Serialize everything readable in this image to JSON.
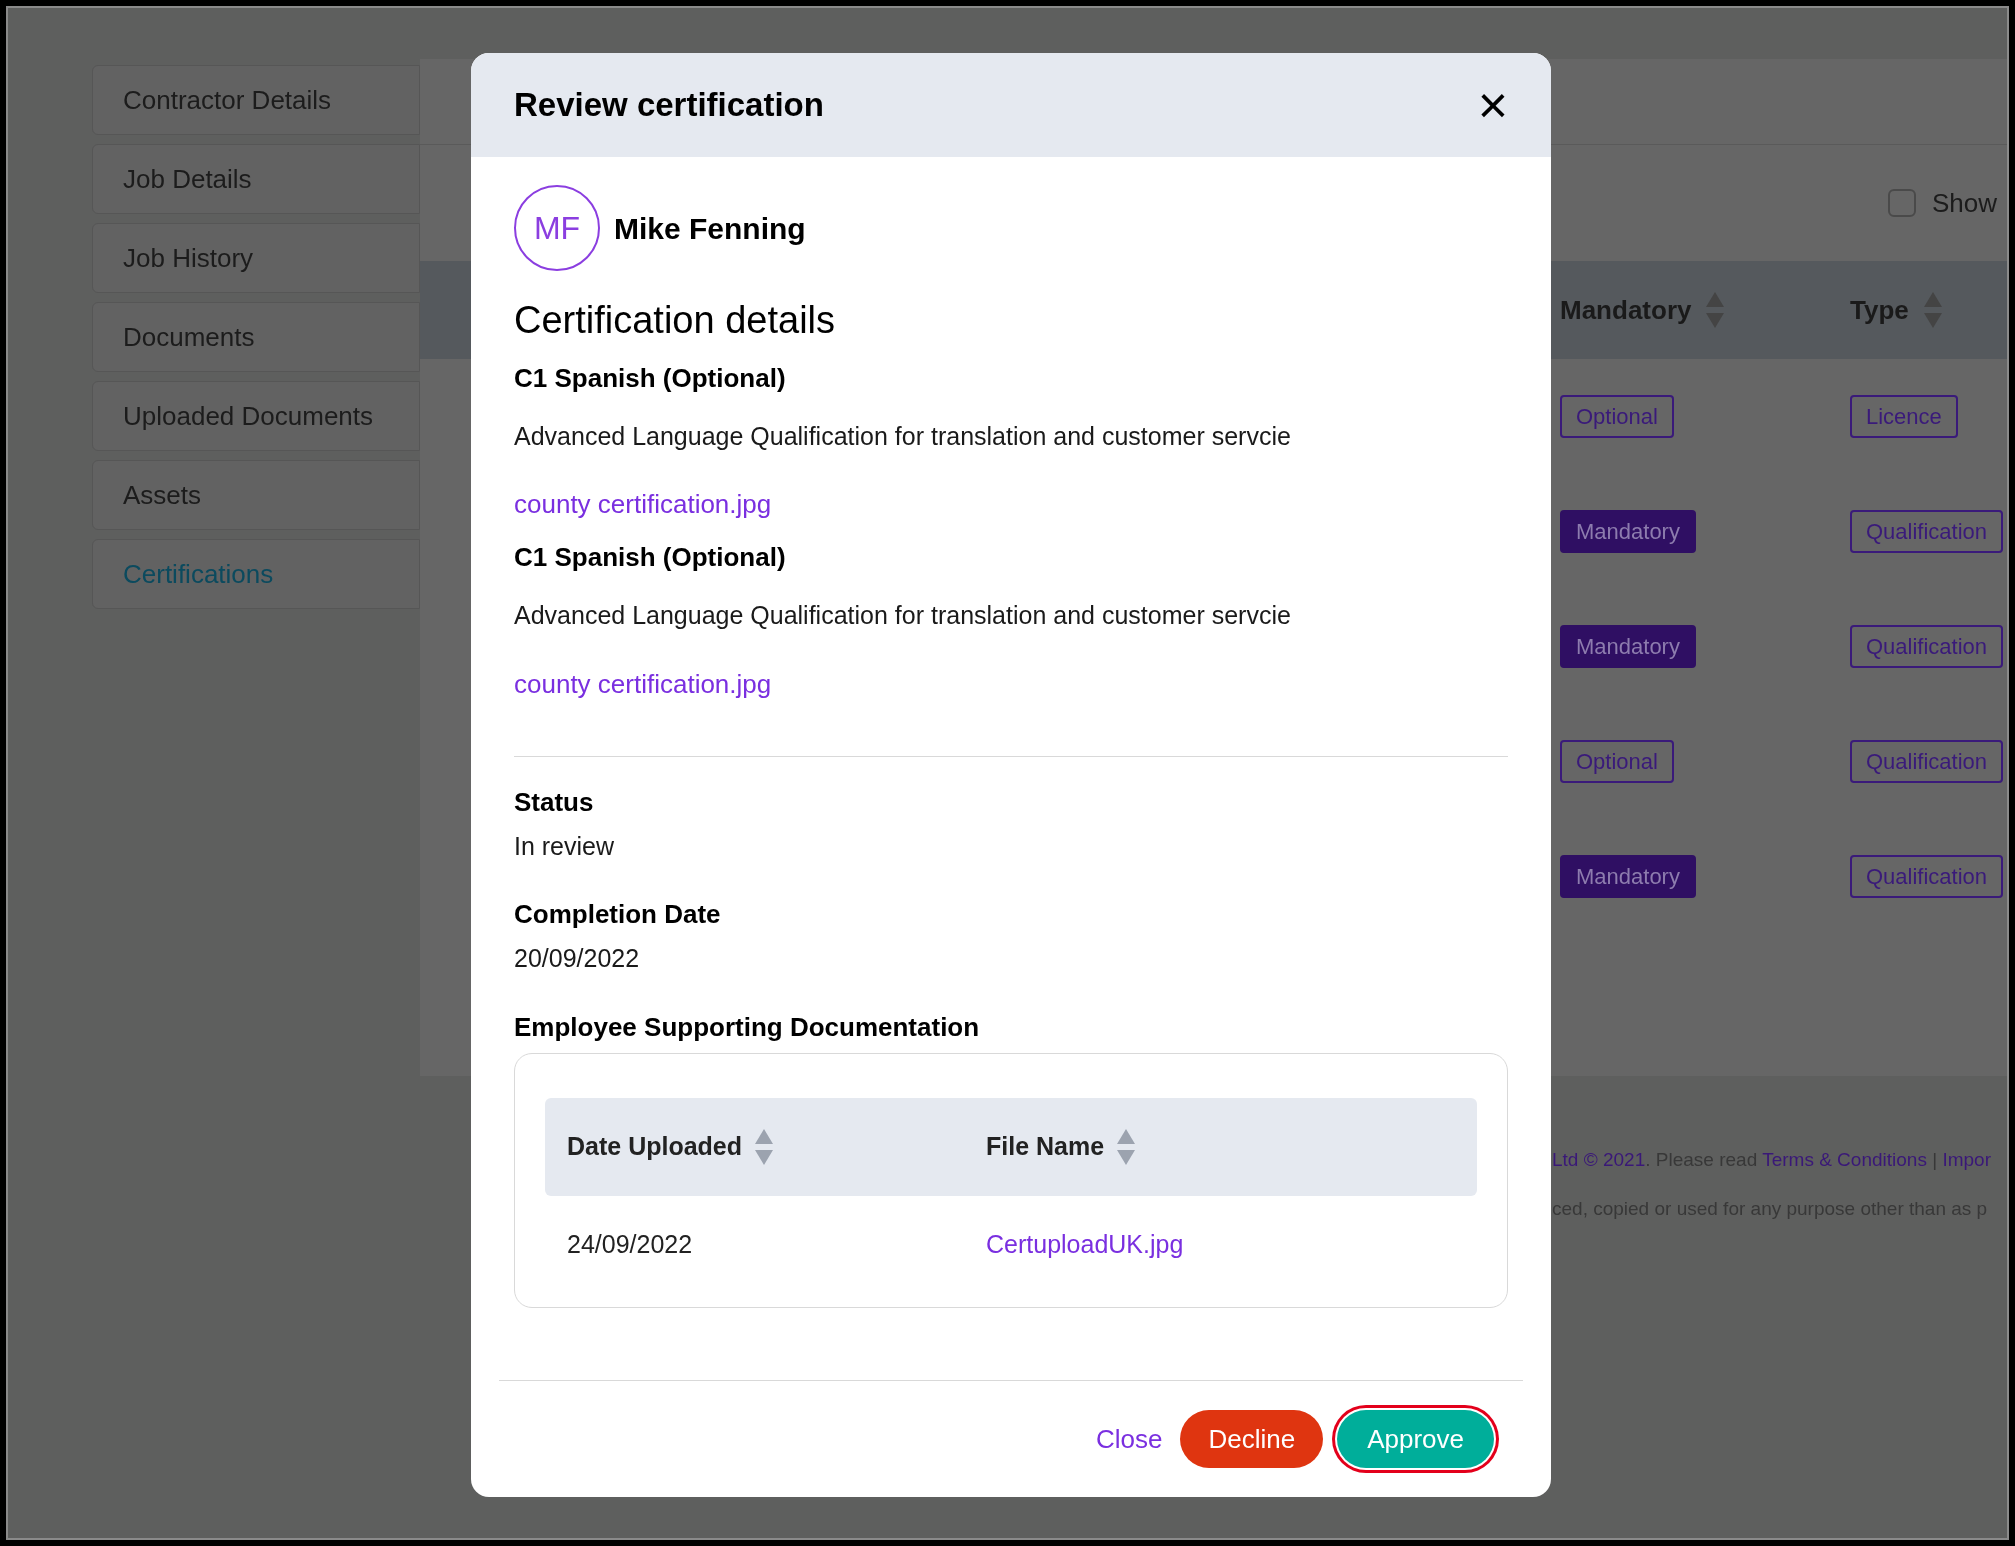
{
  "sidebar": {
    "items": [
      {
        "label": "Contractor Details",
        "selected": false
      },
      {
        "label": "Job Details",
        "selected": false
      },
      {
        "label": "Job History",
        "selected": false
      },
      {
        "label": "Documents",
        "selected": false
      },
      {
        "label": "Uploaded Documents",
        "selected": false
      },
      {
        "label": "Assets",
        "selected": false
      },
      {
        "label": "Certifications",
        "selected": true
      }
    ]
  },
  "filter": {
    "label": "Show",
    "checked": false
  },
  "table": {
    "columns": [
      "Mandatory",
      "Type"
    ],
    "rows": [
      {
        "requirement": "Optional",
        "kind": "optional",
        "type": "Licence"
      },
      {
        "requirement": "Mandatory",
        "kind": "mandatory",
        "type": "Qualification"
      },
      {
        "requirement": "Mandatory",
        "kind": "mandatory",
        "type": "Qualification"
      },
      {
        "requirement": "Optional",
        "kind": "optional",
        "type": "Qualification"
      },
      {
        "requirement": "Mandatory",
        "kind": "mandatory",
        "type": "Qualification"
      }
    ]
  },
  "footer": {
    "lines": [
      [
        {
          "text": "Ltd © 2021",
          "link": true
        },
        {
          "text": ". Please read ",
          "link": false
        },
        {
          "text": "Terms & Conditions",
          "link": true
        },
        {
          "text": " | ",
          "link": false
        },
        {
          "text": "Impor",
          "link": true
        }
      ],
      [
        {
          "text": "ced, copied or used for any purpose other than as p",
          "link": false
        }
      ]
    ]
  },
  "modal": {
    "title": "Review certification",
    "close": "×",
    "person": {
      "initials": "MF",
      "name": "Mike Fenning"
    },
    "section_title": "Certification details",
    "certifications": [
      {
        "title": "C1 Spanish (Optional)",
        "description": "Advanced Language Qualification for translation and customer servcie",
        "file": "county certification.jpg"
      },
      {
        "title": "C1 Spanish (Optional)",
        "description": "Advanced Language Qualification for translation and customer servcie",
        "file": "county certification.jpg"
      }
    ],
    "fields": [
      {
        "label": "Status",
        "value": "In review"
      },
      {
        "label": "Completion Date",
        "value": "20/09/2022"
      }
    ],
    "documentation": {
      "title": "Employee Supporting Documentation",
      "columns": [
        "Date Uploaded",
        "File Name"
      ],
      "rows": [
        {
          "date": "24/09/2022",
          "file": "CertuploadUK.jpg"
        }
      ]
    },
    "buttons": [
      {
        "label": "Close",
        "kind": "link"
      },
      {
        "label": "Decline",
        "kind": "danger"
      },
      {
        "label": "Approve",
        "kind": "primary",
        "focused": true
      }
    ]
  }
}
